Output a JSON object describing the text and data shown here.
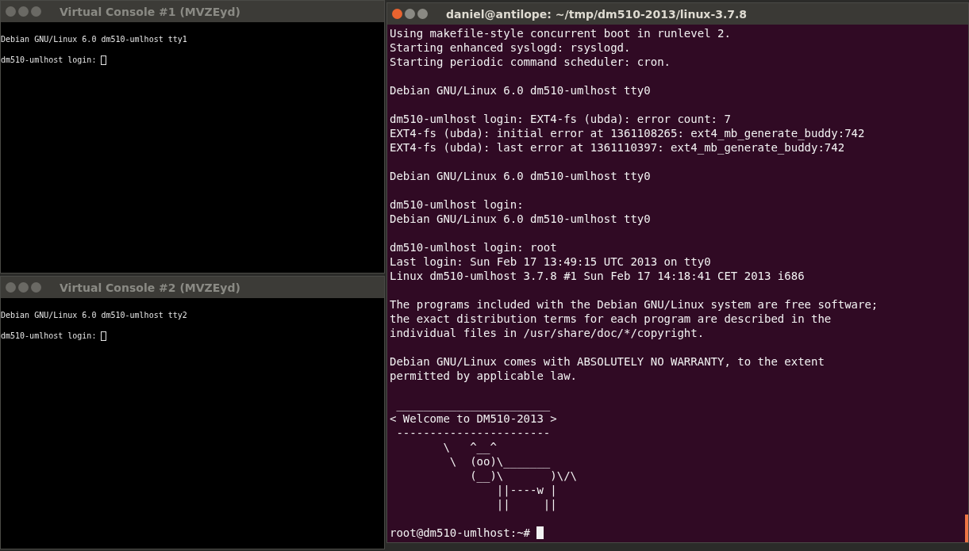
{
  "windows": [
    {
      "title": "Virtual Console #1 (MVZEyd)",
      "active": false,
      "blocks": [
        [
          "Debian GNU/Linux 6.0 dm510-umlhost tty1"
        ],
        [
          "dm510-umlhost login:"
        ]
      ]
    },
    {
      "title": "Virtual Console #2 (MVZEyd)",
      "active": false,
      "blocks": [
        [
          "Debian GNU/Linux 6.0 dm510-umlhost tty2"
        ],
        [
          "dm510-umlhost login:"
        ]
      ]
    },
    {
      "title": "daniel@antilope: ~/tmp/dm510-2013/linux-3.7.8",
      "active": true,
      "blocks": [
        [
          "Using makefile-style concurrent boot in runlevel 2.",
          "Starting enhanced syslogd: rsyslogd.",
          "Starting periodic command scheduler: cron."
        ],
        [
          "Debian GNU/Linux 6.0 dm510-umlhost tty0"
        ],
        [
          "dm510-umlhost login: EXT4-fs (ubda): error count: 7",
          "EXT4-fs (ubda): initial error at 1361108265: ext4_mb_generate_buddy:742",
          "EXT4-fs (ubda): last error at 1361110397: ext4_mb_generate_buddy:742"
        ],
        [
          "Debian GNU/Linux 6.0 dm510-umlhost tty0"
        ],
        [
          "dm510-umlhost login:",
          "Debian GNU/Linux 6.0 dm510-umlhost tty0"
        ],
        [
          "dm510-umlhost login: root",
          "Last login: Sun Feb 17 13:49:15 UTC 2013 on tty0",
          "Linux dm510-umlhost 3.7.8 #1 Sun Feb 17 14:18:41 CET 2013 i686"
        ],
        [
          "The programs included with the Debian GNU/Linux system are free software;",
          "the exact distribution terms for each program are described in the",
          "individual files in /usr/share/doc/*/copyright."
        ],
        [
          "Debian GNU/Linux comes with ABSOLUTELY NO WARRANTY, to the extent",
          "permitted by applicable law."
        ],
        [
          " _______________________",
          "< Welcome to DM510-2013 >",
          " -----------------------",
          "        \\   ^__^",
          "         \\  (oo)\\_______",
          "            (__)\\       )\\/\\",
          "                ||----w |",
          "                ||     ||"
        ],
        [
          "root@dm510-umlhost:~#"
        ]
      ]
    }
  ]
}
